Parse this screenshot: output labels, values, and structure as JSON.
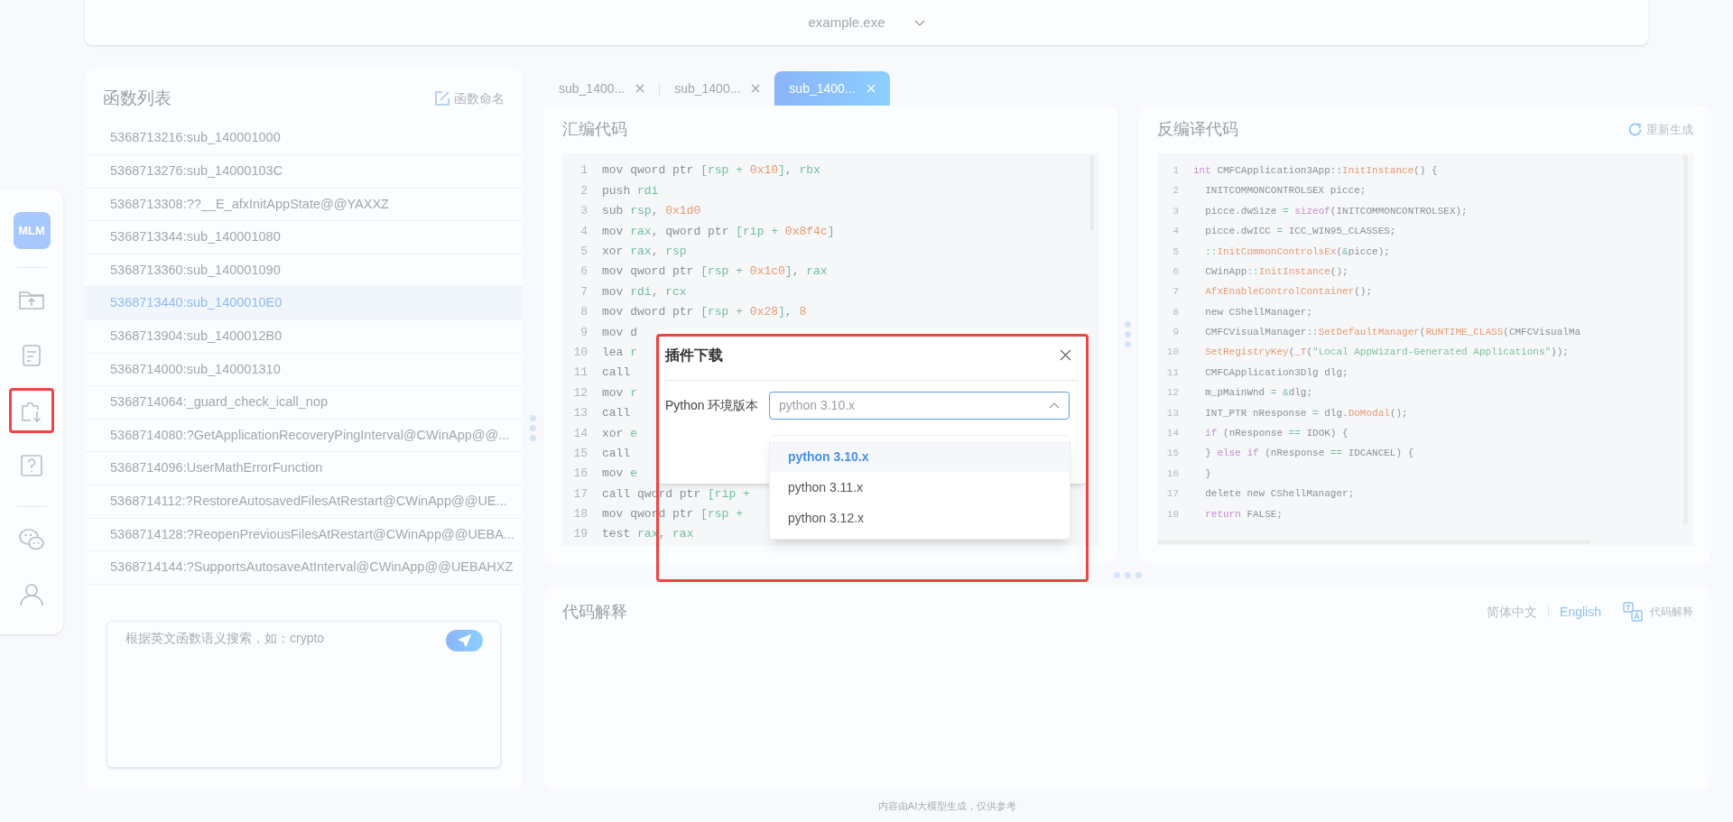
{
  "header": {
    "file_select": "example.exe"
  },
  "nav": {
    "logo": "MLM",
    "items": [
      {
        "kind": "folder-upload",
        "annotated": false
      },
      {
        "kind": "document",
        "annotated": false
      },
      {
        "kind": "plugin-download",
        "annotated": true
      },
      {
        "kind": "help",
        "annotated": false
      },
      {
        "kind": "chat",
        "annotated": false
      },
      {
        "kind": "user",
        "annotated": false
      }
    ]
  },
  "function_list": {
    "title": "函数列表",
    "rename_button": "函数命名",
    "items": [
      {
        "label": "5368713216:sub_140001000",
        "selected": false
      },
      {
        "label": "5368713276:sub_14000103C",
        "selected": false
      },
      {
        "label": "5368713308:??__E_afxInitAppState@@YAXXZ",
        "selected": false
      },
      {
        "label": "5368713344:sub_140001080",
        "selected": false
      },
      {
        "label": "5368713360:sub_140001090",
        "selected": false
      },
      {
        "label": "5368713440:sub_1400010E0",
        "selected": true
      },
      {
        "label": "5368713904:sub_1400012B0",
        "selected": false
      },
      {
        "label": "5368714000:sub_140001310",
        "selected": false
      },
      {
        "label": "5368714064:_guard_check_icall_nop",
        "selected": false
      },
      {
        "label": "5368714080:?GetApplicationRecoveryPingInterval@CWinApp@@...",
        "selected": false
      },
      {
        "label": "5368714096:UserMathErrorFunction",
        "selected": false
      },
      {
        "label": "5368714112:?RestoreAutosavedFilesAtRestart@CWinApp@@UE...",
        "selected": false
      },
      {
        "label": "5368714128:?ReopenPreviousFilesAtRestart@CWinApp@@UEBA...",
        "selected": false
      },
      {
        "label": "5368714144:?SupportsAutosaveAtInterval@CWinApp@@UEBAHXZ",
        "selected": false
      }
    ],
    "search": {
      "placeholder": "根据英文函数语义搜索，如：crypto"
    }
  },
  "tabs": [
    {
      "label": "sub_1400...",
      "selected": false
    },
    {
      "label": "sub_1400...",
      "selected": false
    },
    {
      "label": "sub_1400...",
      "selected": true
    }
  ],
  "assembly": {
    "title": "汇编代码",
    "lines": [
      {
        "n": "1",
        "code": [
          {
            "text": "mov qword ptr ",
            "kind": "p"
          },
          {
            "text": "[rsp + ",
            "kind": "r"
          },
          {
            "text": "0x10",
            "kind": "n"
          },
          {
            "text": "]",
            "kind": "r"
          },
          {
            "text": ", ",
            "kind": "p"
          },
          {
            "text": "rbx",
            "kind": "r"
          }
        ]
      },
      {
        "n": "2",
        "code": [
          {
            "text": "push ",
            "kind": "p"
          },
          {
            "text": "rdi",
            "kind": "r"
          }
        ]
      },
      {
        "n": "3",
        "code": [
          {
            "text": "sub ",
            "kind": "p"
          },
          {
            "text": "rsp",
            "kind": "r"
          },
          {
            "text": ", ",
            "kind": "p"
          },
          {
            "text": "0x1d0",
            "kind": "n"
          }
        ]
      },
      {
        "n": "4",
        "code": [
          {
            "text": "mov ",
            "kind": "p"
          },
          {
            "text": "rax",
            "kind": "r"
          },
          {
            "text": ", qword ptr ",
            "kind": "p"
          },
          {
            "text": "[rip + ",
            "kind": "r"
          },
          {
            "text": "0x8f4c",
            "kind": "n"
          },
          {
            "text": "]",
            "kind": "r"
          }
        ]
      },
      {
        "n": "5",
        "code": [
          {
            "text": "xor ",
            "kind": "p"
          },
          {
            "text": "rax",
            "kind": "r"
          },
          {
            "text": ", ",
            "kind": "p"
          },
          {
            "text": "rsp",
            "kind": "r"
          }
        ]
      },
      {
        "n": "6",
        "code": [
          {
            "text": "mov qword ptr ",
            "kind": "p"
          },
          {
            "text": "[rsp + ",
            "kind": "r"
          },
          {
            "text": "0x1c0",
            "kind": "n"
          },
          {
            "text": "]",
            "kind": "r"
          },
          {
            "text": ", ",
            "kind": "p"
          },
          {
            "text": "rax",
            "kind": "r"
          }
        ]
      },
      {
        "n": "7",
        "code": [
          {
            "text": "mov ",
            "kind": "p"
          },
          {
            "text": "rdi",
            "kind": "r"
          },
          {
            "text": ", ",
            "kind": "p"
          },
          {
            "text": "rcx",
            "kind": "r"
          }
        ]
      },
      {
        "n": "8",
        "code": [
          {
            "text": "mov dword ptr ",
            "kind": "p"
          },
          {
            "text": "[rsp + ",
            "kind": "r"
          },
          {
            "text": "0x28",
            "kind": "n"
          },
          {
            "text": "]",
            "kind": "r"
          },
          {
            "text": ", ",
            "kind": "p"
          },
          {
            "text": "8",
            "kind": "n"
          }
        ]
      },
      {
        "n": "9",
        "code": [
          {
            "text": "mov d",
            "kind": "p"
          }
        ]
      },
      {
        "n": "10",
        "code": [
          {
            "text": "lea ",
            "kind": "p"
          },
          {
            "text": "r",
            "kind": "r"
          }
        ]
      },
      {
        "n": "11",
        "code": [
          {
            "text": "call",
            "kind": "p"
          }
        ]
      },
      {
        "n": "12",
        "code": [
          {
            "text": "mov ",
            "kind": "p"
          },
          {
            "text": "r",
            "kind": "r"
          }
        ]
      },
      {
        "n": "13",
        "code": [
          {
            "text": "call",
            "kind": "p"
          }
        ]
      },
      {
        "n": "14",
        "code": [
          {
            "text": "xor ",
            "kind": "p"
          },
          {
            "text": "e",
            "kind": "r"
          }
        ]
      },
      {
        "n": "15",
        "code": [
          {
            "text": "call",
            "kind": "p"
          }
        ]
      },
      {
        "n": "16",
        "code": [
          {
            "text": "mov ",
            "kind": "p"
          },
          {
            "text": "e",
            "kind": "r"
          }
        ]
      },
      {
        "n": "17",
        "code": [
          {
            "text": "call qword ptr ",
            "kind": "p"
          },
          {
            "text": "[rip +",
            "kind": "r"
          }
        ]
      },
      {
        "n": "18",
        "code": [
          {
            "text": "mov qword ptr ",
            "kind": "p"
          },
          {
            "text": "[rsp +",
            "kind": "r"
          }
        ]
      },
      {
        "n": "19",
        "code": [
          {
            "text": "test ",
            "kind": "p"
          },
          {
            "text": "rax",
            "kind": "r"
          },
          {
            "text": ", ",
            "kind": "p"
          },
          {
            "text": "rax",
            "kind": "r"
          }
        ]
      }
    ]
  },
  "decompiled": {
    "title": "反编译代码",
    "regenerate_button": "重新生成",
    "lines": [
      {
        "n": "1",
        "code": [
          {
            "text": "int ",
            "kind": "k"
          },
          {
            "text": "CMFCApplication3App",
            "kind": "p"
          },
          {
            "text": "::",
            "kind": "o"
          },
          {
            "text": "InitInstance",
            "kind": "f"
          },
          {
            "text": "() {",
            "kind": "o"
          }
        ]
      },
      {
        "n": "2",
        "code": [
          {
            "text": "  INITCOMMONCONTROLSEX picce",
            "kind": "p"
          },
          {
            "text": ";",
            "kind": "o"
          }
        ]
      },
      {
        "n": "3",
        "code": [
          {
            "text": "  picce",
            "kind": "p"
          },
          {
            "text": ".",
            "kind": "o"
          },
          {
            "text": "dwSize ",
            "kind": "p"
          },
          {
            "text": "= ",
            "kind": "r"
          },
          {
            "text": "sizeof",
            "kind": "k"
          },
          {
            "text": "(",
            "kind": "o"
          },
          {
            "text": "INITCOMMONCONTROLSEX",
            "kind": "p"
          },
          {
            "text": ");",
            "kind": "o"
          }
        ]
      },
      {
        "n": "4",
        "code": [
          {
            "text": "  picce",
            "kind": "p"
          },
          {
            "text": ".",
            "kind": "o"
          },
          {
            "text": "dwICC ",
            "kind": "p"
          },
          {
            "text": "= ",
            "kind": "r"
          },
          {
            "text": "ICC_WIN95_CLASSES",
            "kind": "p"
          },
          {
            "text": ";",
            "kind": "o"
          }
        ]
      },
      {
        "n": "5",
        "code": [
          {
            "text": "  ::",
            "kind": "r"
          },
          {
            "text": "InitCommonControlsEx",
            "kind": "f"
          },
          {
            "text": "(",
            "kind": "o"
          },
          {
            "text": "&",
            "kind": "r"
          },
          {
            "text": "picce",
            "kind": "p"
          },
          {
            "text": ");",
            "kind": "o"
          }
        ]
      },
      {
        "n": "6",
        "code": [
          {
            "text": "  CWinApp",
            "kind": "p"
          },
          {
            "text": "::",
            "kind": "r"
          },
          {
            "text": "InitInstance",
            "kind": "f"
          },
          {
            "text": "();",
            "kind": "o"
          }
        ]
      },
      {
        "n": "7",
        "code": [
          {
            "text": "  AfxEnableControlContainer",
            "kind": "f"
          },
          {
            "text": "();",
            "kind": "o"
          }
        ]
      },
      {
        "n": "8",
        "code": [
          {
            "text": "  new CShellManager",
            "kind": "p"
          },
          {
            "text": ";",
            "kind": "o"
          }
        ]
      },
      {
        "n": "9",
        "code": [
          {
            "text": "  CMFCVisualManager",
            "kind": "p"
          },
          {
            "text": "::",
            "kind": "r"
          },
          {
            "text": "SetDefaultManager",
            "kind": "f"
          },
          {
            "text": "(",
            "kind": "o"
          },
          {
            "text": "RUNTIME_CLASS",
            "kind": "f"
          },
          {
            "text": "(",
            "kind": "o"
          },
          {
            "text": "CMFCVisualMa",
            "kind": "p"
          }
        ]
      },
      {
        "n": "10",
        "code": [
          {
            "text": "  SetRegistryKey",
            "kind": "f"
          },
          {
            "text": "(",
            "kind": "o"
          },
          {
            "text": "_T",
            "kind": "f"
          },
          {
            "text": "(",
            "kind": "o"
          },
          {
            "text": "\"Local AppWizard-Generated Applications\"",
            "kind": "s"
          },
          {
            "text": "));",
            "kind": "o"
          }
        ]
      },
      {
        "n": "11",
        "code": [
          {
            "text": "  CMFCApplication3Dlg dlg",
            "kind": "p"
          },
          {
            "text": ";",
            "kind": "o"
          }
        ]
      },
      {
        "n": "12",
        "code": [
          {
            "text": "  m_pMainWnd ",
            "kind": "p"
          },
          {
            "text": "= &",
            "kind": "r"
          },
          {
            "text": "dlg",
            "kind": "p"
          },
          {
            "text": ";",
            "kind": "o"
          }
        ]
      },
      {
        "n": "13",
        "code": [
          {
            "text": "  INT_PTR nResponse ",
            "kind": "p"
          },
          {
            "text": "= ",
            "kind": "r"
          },
          {
            "text": "dlg",
            "kind": "p"
          },
          {
            "text": ".",
            "kind": "o"
          },
          {
            "text": "DoModal",
            "kind": "f"
          },
          {
            "text": "();",
            "kind": "o"
          }
        ]
      },
      {
        "n": "14",
        "code": [
          {
            "text": "  if ",
            "kind": "k"
          },
          {
            "text": "(",
            "kind": "o"
          },
          {
            "text": "nResponse ",
            "kind": "p"
          },
          {
            "text": "== ",
            "kind": "r"
          },
          {
            "text": "IDOK",
            "kind": "p"
          },
          {
            "text": ") {",
            "kind": "o"
          }
        ]
      },
      {
        "n": "15",
        "code": [
          {
            "text": "  } ",
            "kind": "o"
          },
          {
            "text": "else if ",
            "kind": "k"
          },
          {
            "text": "(",
            "kind": "o"
          },
          {
            "text": "nResponse ",
            "kind": "p"
          },
          {
            "text": "== ",
            "kind": "r"
          },
          {
            "text": "IDCANCEL",
            "kind": "p"
          },
          {
            "text": ") {",
            "kind": "o"
          }
        ]
      },
      {
        "n": "16",
        "code": [
          {
            "text": "  }",
            "kind": "o"
          }
        ]
      },
      {
        "n": "17",
        "code": [
          {
            "text": "  delete new CShellManager",
            "kind": "p"
          },
          {
            "text": ";",
            "kind": "o"
          }
        ]
      },
      {
        "n": "18",
        "code": [
          {
            "text": "  return ",
            "kind": "k"
          },
          {
            "text": "FALSE",
            "kind": "p"
          },
          {
            "text": ";",
            "kind": "o"
          }
        ]
      }
    ]
  },
  "explanation": {
    "title": "代码解释",
    "languages": [
      {
        "label": "简体中文",
        "selected": false
      },
      {
        "label": "English",
        "selected": true
      }
    ],
    "explain_button": "代码解释"
  },
  "footer": "内容由AI大模型生成，仅供参考",
  "dialog": {
    "title": "插件下载",
    "annotated": true,
    "field_label": "Python 环境版本",
    "select": {
      "value": "python 3.10.x",
      "expanded": true,
      "options": [
        {
          "label": "python 3.10.x",
          "selected": true
        },
        {
          "label": "python 3.11.x",
          "selected": false
        },
        {
          "label": "python 3.12.x",
          "selected": false
        }
      ]
    }
  }
}
